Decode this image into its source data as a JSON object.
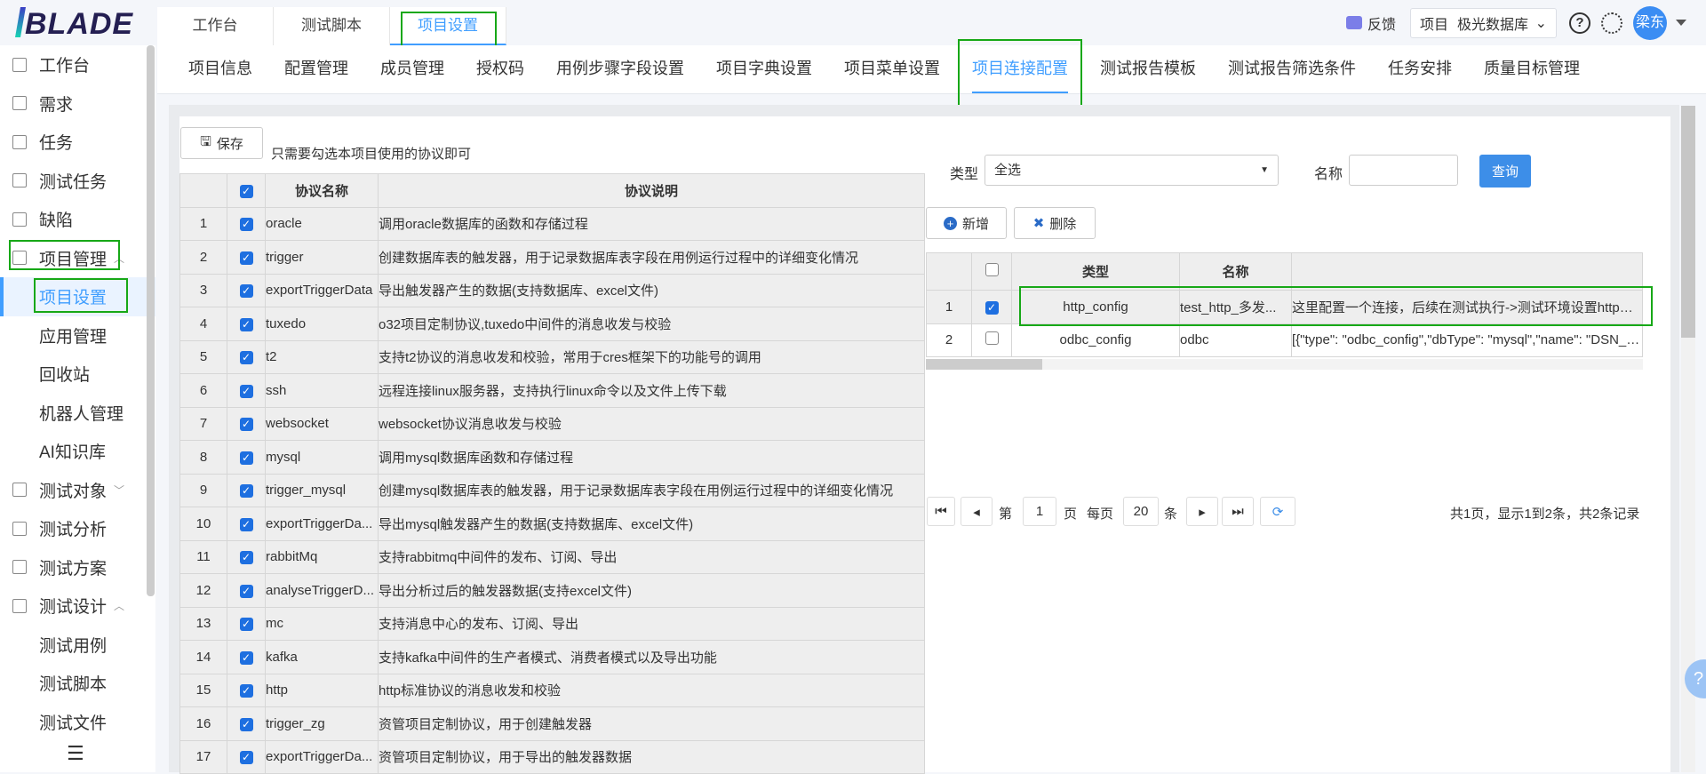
{
  "header": {
    "logo": "BLADE",
    "tabs": [
      "工作台",
      "测试脚本",
      "项目设置"
    ],
    "feedback": "反馈",
    "project_label": "项目",
    "project_value": "极光数据库",
    "user": "梁东"
  },
  "sidebar": {
    "items": [
      {
        "label": "工作台",
        "type": "top"
      },
      {
        "label": "需求",
        "type": "top"
      },
      {
        "label": "任务",
        "type": "top"
      },
      {
        "label": "测试任务",
        "type": "top"
      },
      {
        "label": "缺陷",
        "type": "top"
      },
      {
        "label": "项目管理",
        "type": "top",
        "chev": "^"
      },
      {
        "label": "项目设置",
        "type": "sub",
        "active": true
      },
      {
        "label": "应用管理",
        "type": "sub"
      },
      {
        "label": "回收站",
        "type": "sub"
      },
      {
        "label": "机器人管理",
        "type": "sub"
      },
      {
        "label": "AI知识库",
        "type": "sub"
      },
      {
        "label": "测试对象",
        "type": "top",
        "chev": "v"
      },
      {
        "label": "测试分析",
        "type": "top"
      },
      {
        "label": "测试方案",
        "type": "top"
      },
      {
        "label": "测试设计",
        "type": "top",
        "chev": "^"
      },
      {
        "label": "测试用例",
        "type": "sub"
      },
      {
        "label": "测试脚本",
        "type": "sub"
      },
      {
        "label": "测试文件",
        "type": "sub"
      }
    ]
  },
  "subnav": {
    "tabs": [
      "项目信息",
      "配置管理",
      "成员管理",
      "授权码",
      "用例步骤字段设置",
      "项目字典设置",
      "项目菜单设置",
      "项目连接配置",
      "测试报告模板",
      "测试报告筛选条件",
      "任务安排",
      "质量目标管理"
    ],
    "active": 7
  },
  "left": {
    "save": "保存",
    "hint": "只需要勾选本项目使用的协议即可",
    "headers": [
      "协议名称",
      "协议说明"
    ],
    "rows": [
      [
        "1",
        "oracle",
        "调用oracle数据库的函数和存储过程"
      ],
      [
        "2",
        "trigger",
        "创建数据库表的触发器，用于记录数据库表字段在用例运行过程中的详细变化情况"
      ],
      [
        "3",
        "exportTriggerData",
        "导出触发器产生的数据(支持数据库、excel文件)"
      ],
      [
        "4",
        "tuxedo",
        "o32项目定制协议,tuxedo中间件的消息收发与校验"
      ],
      [
        "5",
        "t2",
        "支持t2协议的消息收发和校验，常用于cres框架下的功能号的调用"
      ],
      [
        "6",
        "ssh",
        "远程连接linux服务器，支持执行linux命令以及文件上传下载"
      ],
      [
        "7",
        "websocket",
        "websocket协议消息收发与校验"
      ],
      [
        "8",
        "mysql",
        "调用mysql数据库函数和存储过程"
      ],
      [
        "9",
        "trigger_mysql",
        "创建mysql数据库表的触发器，用于记录数据库表字段在用例运行过程中的详细变化情况"
      ],
      [
        "10",
        "exportTriggerDa...",
        "导出mysql触发器产生的数据(支持数据库、excel文件)"
      ],
      [
        "11",
        "rabbitMq",
        "支持rabbitmq中间件的发布、订阅、导出"
      ],
      [
        "12",
        "analyseTriggerD...",
        "导出分析过后的触发器数据(支持excel文件)"
      ],
      [
        "13",
        "mc",
        "支持消息中心的发布、订阅、导出"
      ],
      [
        "14",
        "kafka",
        "支持kafka中间件的生产者模式、消费者模式以及导出功能"
      ],
      [
        "15",
        "http",
        "http标准协议的消息收发和校验"
      ],
      [
        "16",
        "trigger_zg",
        "资管项目定制协议，用于创建触发器"
      ],
      [
        "17",
        "exportTriggerDa...",
        "资管项目定制协议，用于导出的触发器数据"
      ]
    ]
  },
  "right": {
    "type_label": "类型",
    "type_value": "全选",
    "name_label": "名称",
    "name_value": "",
    "query": "查询",
    "add": "新增",
    "delete": "删除",
    "headers": [
      "类型",
      "名称",
      ""
    ],
    "rows": [
      [
        "1",
        true,
        "http_config",
        "test_http_多发...",
        "这里配置一个连接，后续在测试执行->测试环境设置http服务"
      ],
      [
        "2",
        false,
        "odbc_config",
        "odbc",
        "[{\"type\": \"odbc_config\",\"dbType\": \"mysql\",\"name\": \"DSN_MY"
      ]
    ],
    "pager": {
      "page_prefix": "第",
      "page": "1",
      "page_suffix": "页",
      "per_prefix": "每页",
      "per": "20",
      "per_suffix": "条",
      "summary": "共1页，显示1到2条，共2条记录"
    }
  },
  "colors": {
    "accent": "#409eff",
    "highlight": "#17a817"
  }
}
